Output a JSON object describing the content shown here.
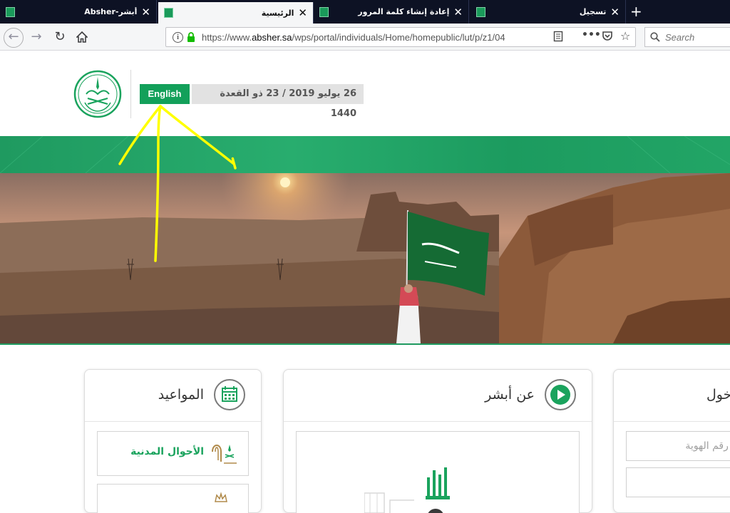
{
  "browser": {
    "tabs": [
      {
        "title": "أبشر-Absher",
        "active": false
      },
      {
        "title": "الرئيسية",
        "active": true
      },
      {
        "title": "إعادة إنشاء كلمة المرور",
        "active": false
      },
      {
        "title": "تسجيل",
        "active": false
      }
    ],
    "url_prefix": "https://www.",
    "url_host": "absher.sa",
    "url_path": "/wps/portal/individuals/Home/homepublic/lut/p/z1/04",
    "search_placeholder": "Search",
    "colors": {
      "tab_strip": "#0d1224",
      "toolbar": "#f5f6f7",
      "secure_lock": "#12bc00"
    }
  },
  "header": {
    "language_button": "English",
    "date_text": "26 يوليو 2019 / 23 ذو القعدة 1440",
    "colors": {
      "accent_green": "#13a05a",
      "date_bg": "#e2e2e2"
    }
  },
  "cards": {
    "appointments": {
      "title": "المواعيد",
      "icon": "calendar-icon",
      "services": [
        {
          "label": "الأحوال المدنية",
          "logo": "civil-affairs-logo"
        }
      ]
    },
    "about": {
      "title": "عن أبشر",
      "icon": "play-icon"
    },
    "login": {
      "title_partial": "خول",
      "id_placeholder": "أو رقم الهوية"
    }
  },
  "annotation": {
    "color": "#ffff00",
    "shape": "arrow-pointing-to-language-button"
  }
}
